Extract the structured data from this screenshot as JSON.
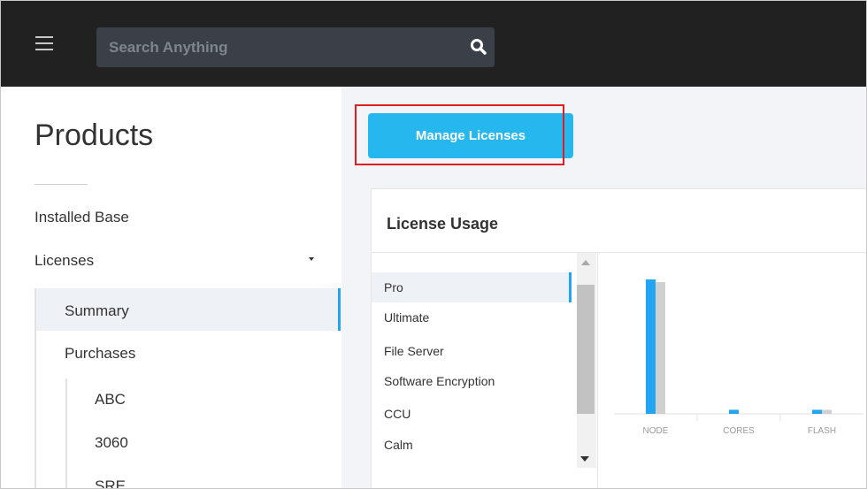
{
  "search": {
    "placeholder": "Search Anything"
  },
  "sidebar": {
    "title": "Products",
    "items": {
      "installed_base": "Installed Base",
      "licenses": "Licenses"
    },
    "licenses_sub": {
      "summary": "Summary",
      "purchases": "Purchases"
    },
    "purchases_sub": [
      "ABC",
      "3060",
      "SRE"
    ]
  },
  "main": {
    "manage_button": "Manage Licenses",
    "card": {
      "title": "License Usage",
      "products": [
        "Pro",
        "Ultimate",
        "File Server",
        "Software Encryption",
        "CCU",
        "Calm"
      ],
      "selected_product": "Pro"
    }
  },
  "colors": {
    "accent": "#22a5f3",
    "button": "#26b7ef",
    "highlight": "#e11d24",
    "used": "#22a5f3",
    "available": "#d0d0d0"
  },
  "chart_data": {
    "type": "bar",
    "categories": [
      "NODE",
      "CORES",
      "FLASH"
    ],
    "series": [
      {
        "values": [
          100,
          3,
          3
        ]
      },
      {
        "values": [
          98,
          0,
          3
        ]
      }
    ],
    "ylim": [
      0,
      100
    ],
    "grid": false,
    "legend": "none"
  }
}
